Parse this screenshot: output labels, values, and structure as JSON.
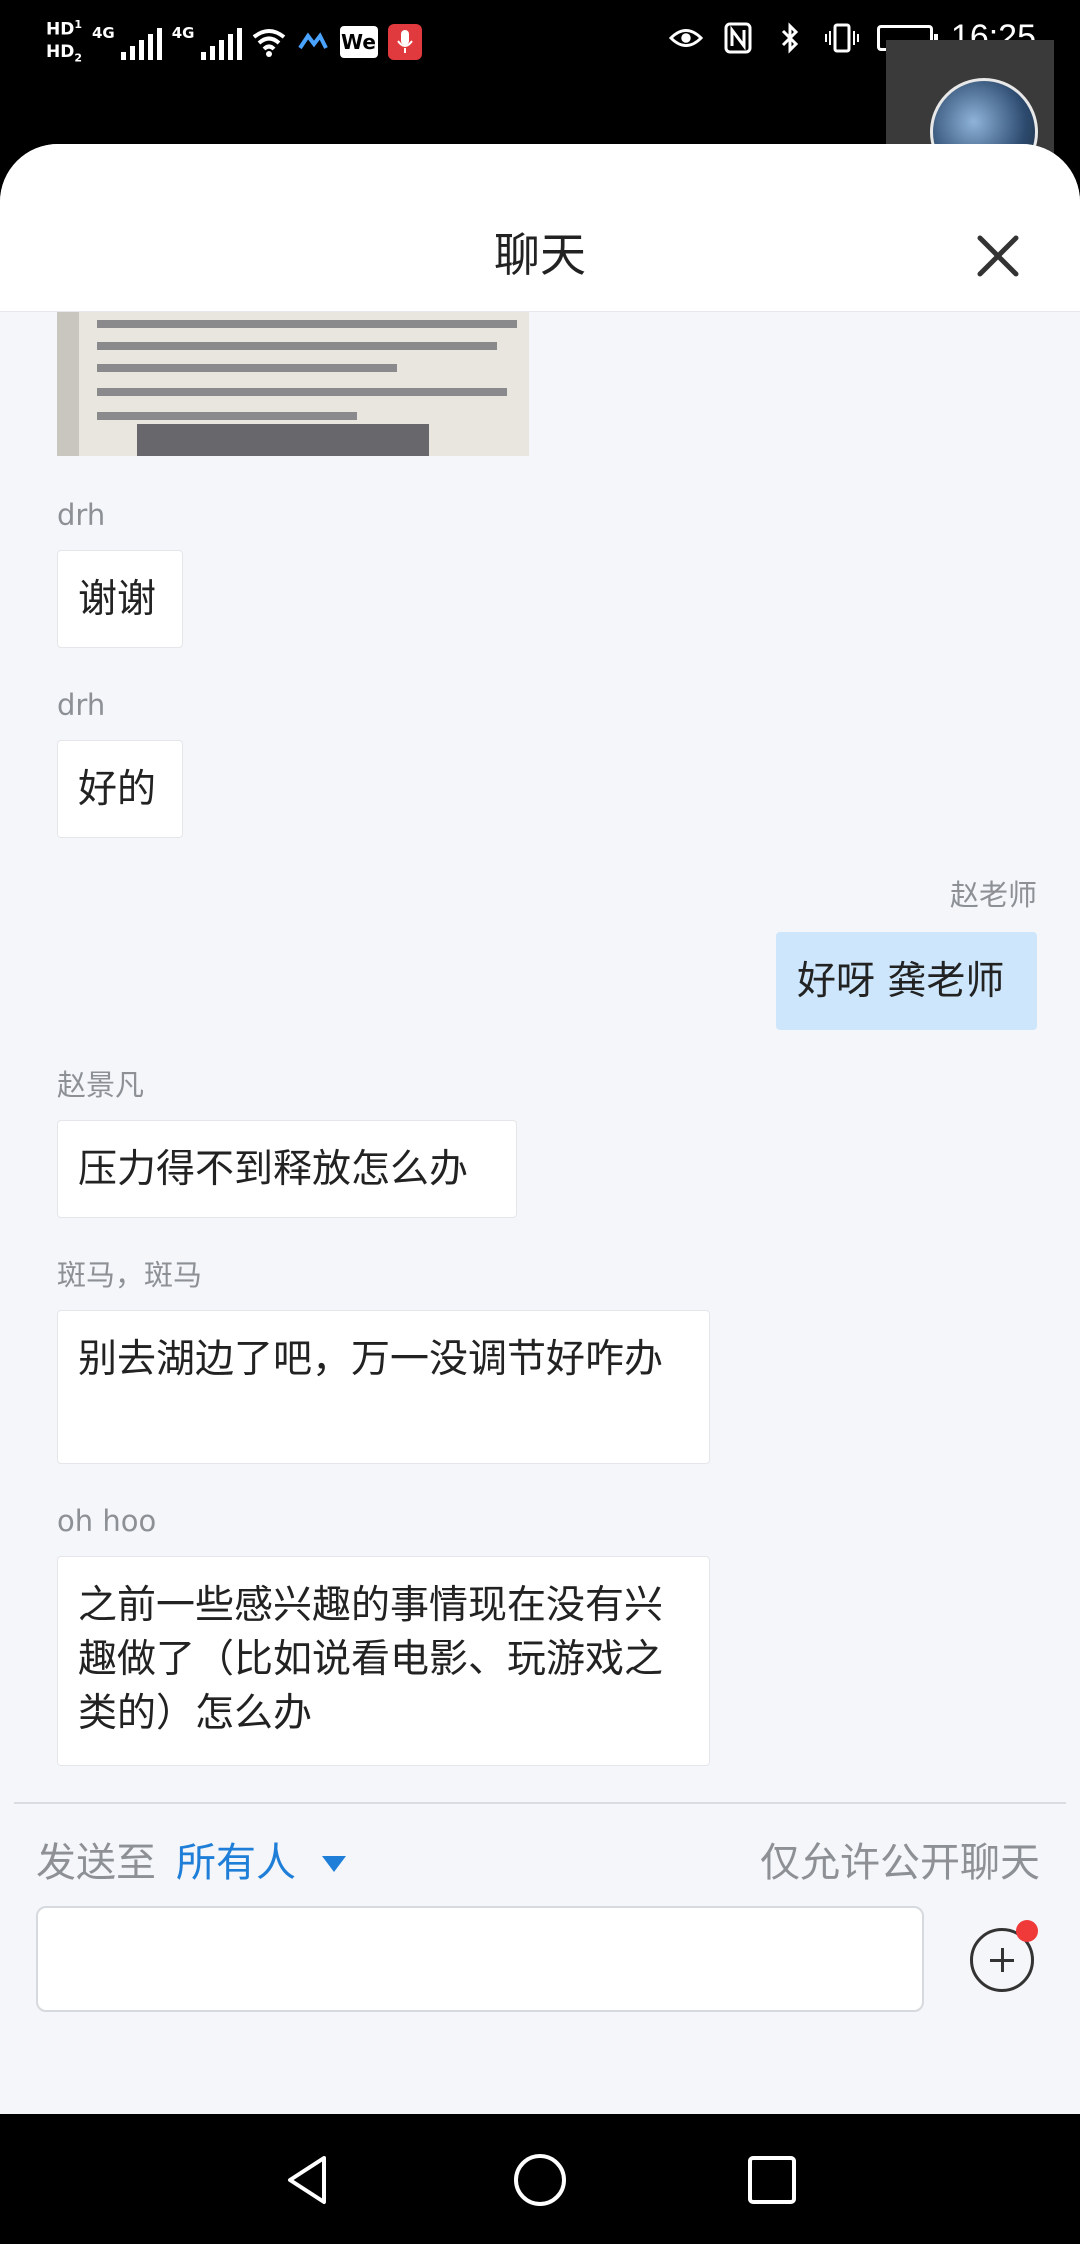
{
  "status_bar": {
    "hd1": "HD",
    "hd1_sub": "1",
    "hd2": "HD",
    "hd2_sub": "2",
    "net1": "4G",
    "net2": "4G",
    "we_app": "We",
    "time": "16:25"
  },
  "header": {
    "title": "聊天"
  },
  "messages": [
    {
      "sender": "drh",
      "text": "谢谢",
      "mine": false
    },
    {
      "sender": "drh",
      "text": "好的",
      "mine": false
    },
    {
      "sender": "赵老师",
      "text": "好呀 龚老师",
      "mine": true
    },
    {
      "sender": "赵景凡",
      "text": "压力得不到释放怎么办",
      "mine": false
    },
    {
      "sender": "斑马，斑马",
      "text": "别去湖边了吧，万一没调节好咋办",
      "mine": false
    },
    {
      "sender": "oh hoo",
      "text": "之前一些感兴趣的事情现在没有兴趣做了（比如说看电影、玩游戏之类的）怎么办",
      "mine": false
    }
  ],
  "footer": {
    "send_to_label": "发送至",
    "send_target": "所有人",
    "public_only": "仅允许公开聊天",
    "input_value": "",
    "has_notification": true
  },
  "icons": {
    "close": "close-icon",
    "add": "plus-circle-icon",
    "back": "back-triangle-icon",
    "home": "home-circle-icon",
    "recents": "recents-square-icon"
  },
  "colors": {
    "accent": "#1f7fd8",
    "my_bubble": "#cde6fb",
    "notification": "#f03a3a"
  }
}
